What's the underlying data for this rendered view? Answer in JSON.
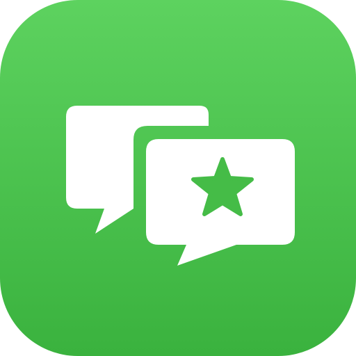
{
  "app_icon": {
    "icon_name": "chat-bubbles-star-icon",
    "colors": {
      "gradient_top": "#5DD25F",
      "gradient_bottom": "#3AB23E",
      "glyph": "#FFFFFF",
      "star": "#45BC47"
    }
  }
}
